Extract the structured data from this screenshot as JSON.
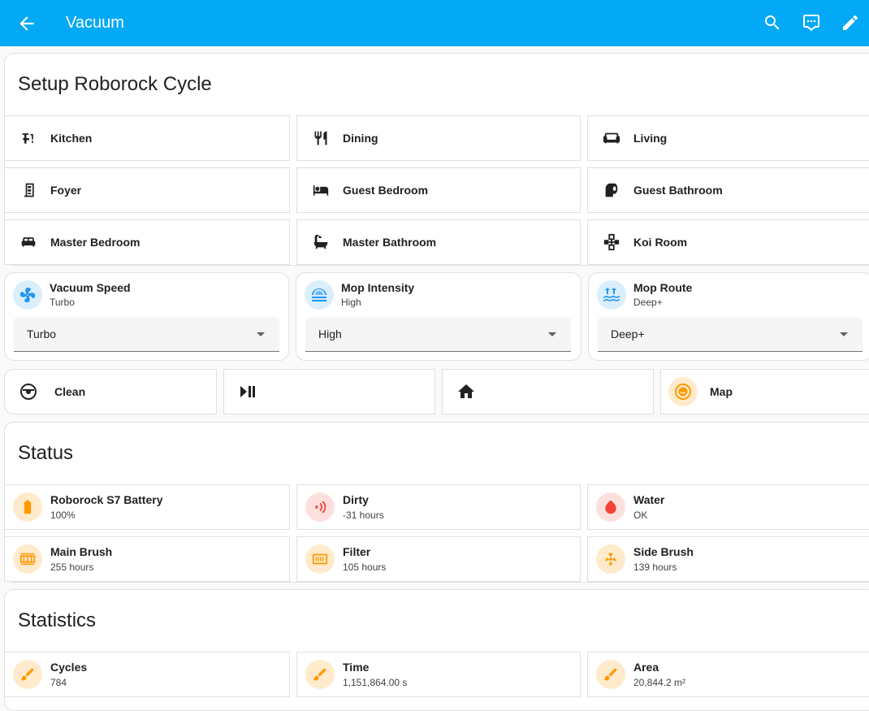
{
  "header": {
    "title": "Vacuum",
    "back_icon": "arrow-left-icon",
    "actions": [
      "search-icon",
      "assist-icon",
      "pencil-icon"
    ]
  },
  "setup": {
    "title": "Setup Roborock Cycle",
    "rooms": [
      {
        "label": "Kitchen",
        "icon": "faucet-icon"
      },
      {
        "label": "Dining",
        "icon": "silverware-icon"
      },
      {
        "label": "Living",
        "icon": "sofa-icon"
      },
      {
        "label": "Foyer",
        "icon": "door-icon"
      },
      {
        "label": "Guest Bedroom",
        "icon": "bed-icon"
      },
      {
        "label": "Guest Bathroom",
        "icon": "toilet-paper-icon"
      },
      {
        "label": "Master Bedroom",
        "icon": "bed-double-icon"
      },
      {
        "label": "Master Bathroom",
        "icon": "bathtub-icon"
      },
      {
        "label": "Koi Room",
        "icon": "fish-pond-icon"
      }
    ]
  },
  "selects": [
    {
      "name": "Vacuum Speed",
      "state": "Turbo",
      "value": "Turbo",
      "icon": "fan-icon"
    },
    {
      "name": "Mop Intensity",
      "state": "High",
      "value": "High",
      "icon": "waves-icon"
    },
    {
      "name": "Mop Route",
      "state": "Deep+",
      "value": "Deep+",
      "icon": "water-route-icon"
    }
  ],
  "controls": {
    "clean_label": "Clean",
    "map_label": "Map",
    "play_pause_icon": "play-pause-icon",
    "home_icon": "home-icon"
  },
  "status": {
    "title": "Status",
    "items": [
      {
        "name": "Roborock S7 Battery",
        "value": "100%",
        "icon": "battery-icon"
      },
      {
        "name": "Dirty",
        "value": "-31 hours",
        "icon": "signal-icon"
      },
      {
        "name": "Water",
        "value": "OK",
        "icon": "water-drop-icon"
      },
      {
        "name": "Main Brush",
        "value": "255 hours",
        "icon": "brush-roller-icon"
      },
      {
        "name": "Filter",
        "value": "105 hours",
        "icon": "air-filter-icon"
      },
      {
        "name": "Side Brush",
        "value": "139 hours",
        "icon": "side-brush-icon"
      }
    ]
  },
  "statistics": {
    "title": "Statistics",
    "items": [
      {
        "name": "Cycles",
        "value": "784",
        "icon": "brush-icon"
      },
      {
        "name": "Time",
        "value": "1,151,864.00 s",
        "icon": "brush-icon"
      },
      {
        "name": "Area",
        "value": "20,844.2 m²",
        "icon": "brush-icon"
      }
    ]
  },
  "colors": {
    "header": "#03a9f4",
    "blue_badge": "#dbeefb",
    "orange": "#ff9800",
    "orange_badge": "#ffebcc",
    "red": "#f44336",
    "red_badge": "#fde0de"
  }
}
